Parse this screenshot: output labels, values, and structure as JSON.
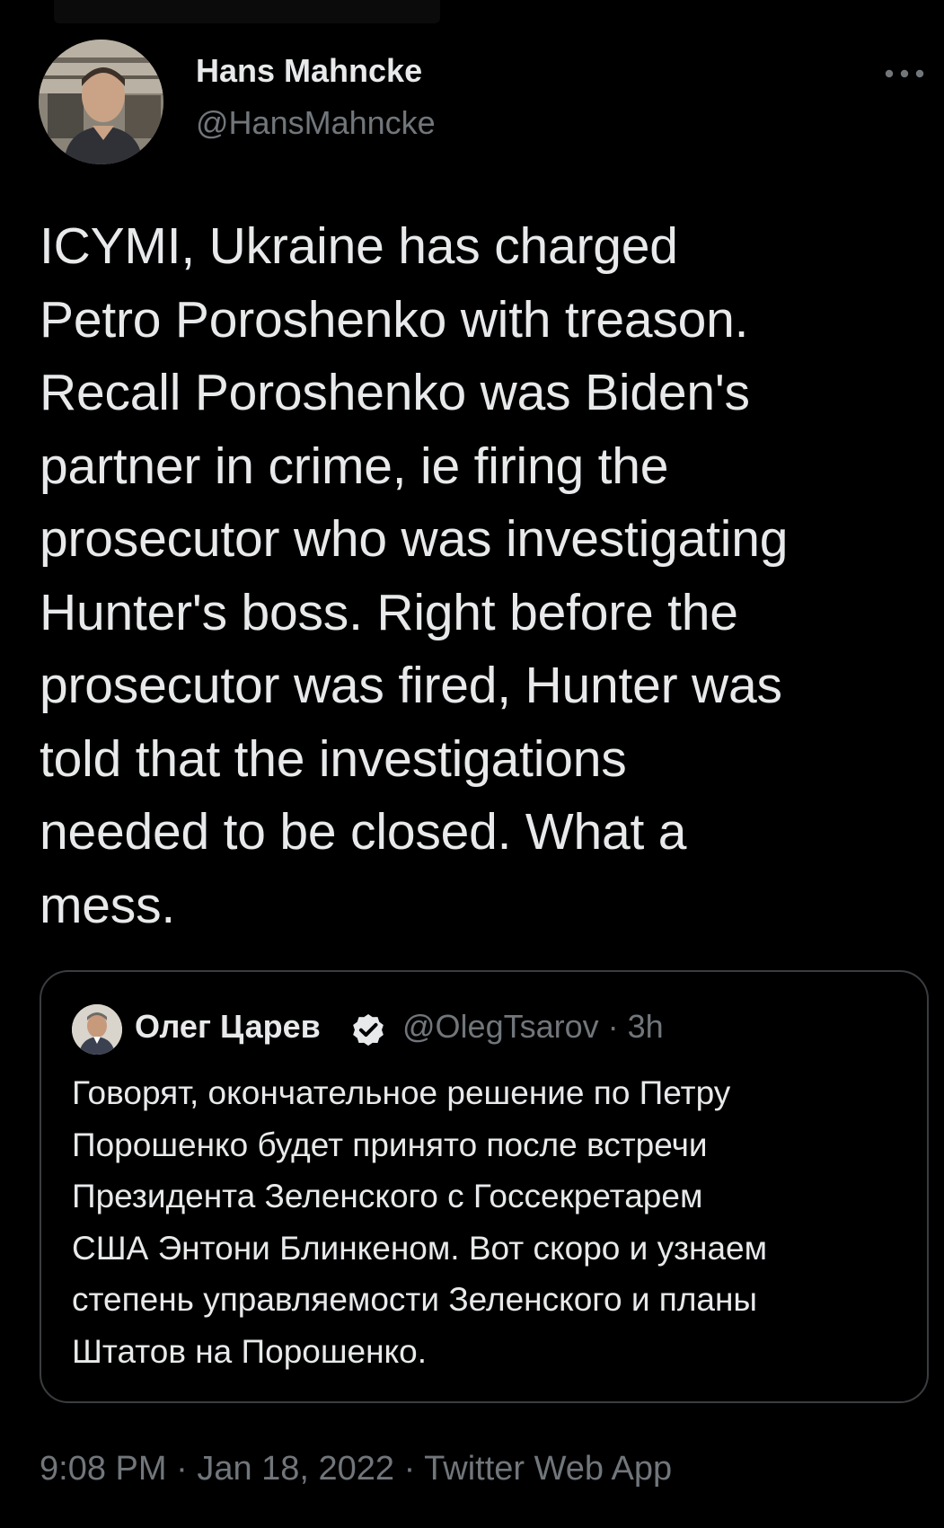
{
  "tweet": {
    "author": {
      "name": "Hans Mahncke",
      "handle": "@HansMahncke"
    },
    "text": "ICYMI, Ukraine has charged\nPetro Poroshenko with treason.\nRecall Poroshenko was Biden's\npartner in crime, ie firing the\nprosecutor who was investigating\nHunter's boss. Right before the\nprosecutor was fired, Hunter was\ntold that the investigations\nneeded to be closed. What a\nmess.",
    "time": "9:08 PM",
    "date": "Jan 18, 2022",
    "source": "Twitter Web App",
    "separator": "·"
  },
  "quoted_tweet": {
    "author": {
      "name": "Олег Царев",
      "handle": "@OlegTsarov",
      "verified": true
    },
    "age": "3h",
    "meta_separator": "·",
    "text": "Говорят, окончательное решение по Петру\nПорошенко будет принято после встречи\nПрезидента Зеленского с Госсекретарем\nСША Энтони Блинкеном. Вот скоро и узнаем\nстепень управляемости Зеленского и планы\nШтатов на Порошенко."
  },
  "icons": {
    "more": "more-horizontal-icon",
    "verified": "verified-badge-icon"
  },
  "colors": {
    "background": "#000000",
    "text_primary": "#e7e9ea",
    "text_secondary": "#71767b",
    "card_border": "#3a3d40"
  }
}
